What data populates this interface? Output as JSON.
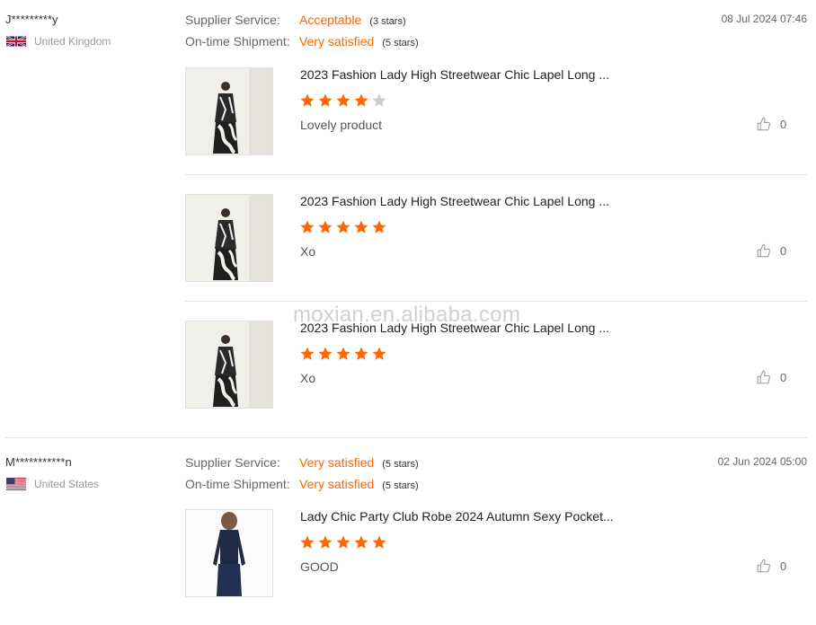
{
  "reviews": [
    {
      "name": "J*********y",
      "country": "United Kingdom",
      "flag_icon": "uk-flag-icon",
      "date": "08 Jul 2024 07:46",
      "supplier_service": {
        "label": "Supplier Service:",
        "value": "Acceptable",
        "stars": "(3 stars)"
      },
      "shipment": {
        "label": "On-time Shipment:",
        "value": "Very satisfied",
        "stars": "(5 stars)"
      },
      "items": [
        {
          "title": "2023 Fashion Lady High Streetwear Chic Lapel Long ...",
          "rating": 4,
          "comment": "Lovely product",
          "likes": "0"
        },
        {
          "title": "2023 Fashion Lady High Streetwear Chic Lapel Long ...",
          "rating": 5,
          "comment": "Xo",
          "likes": "0"
        },
        {
          "title": "2023 Fashion Lady High Streetwear Chic Lapel Long ...",
          "rating": 5,
          "comment": "Xo",
          "likes": "0"
        }
      ]
    },
    {
      "name": "M***********n",
      "country": "United States",
      "flag_icon": "us-flag-icon",
      "date": "02 Jun 2024 05:00",
      "supplier_service": {
        "label": "Supplier Service:",
        "value": "Very satisfied",
        "stars": "(5 stars)"
      },
      "shipment": {
        "label": "On-time Shipment:",
        "value": "Very satisfied",
        "stars": "(5 stars)"
      },
      "items": [
        {
          "title": "Lady Chic Party Club Robe 2024 Autumn Sexy Pocket...",
          "rating": 5,
          "comment": "GOOD",
          "likes": "0"
        }
      ]
    }
  ],
  "watermark": "moxian.en.alibaba.com",
  "colors": {
    "accent": "#ff6600",
    "star_empty": "#cccccc"
  }
}
